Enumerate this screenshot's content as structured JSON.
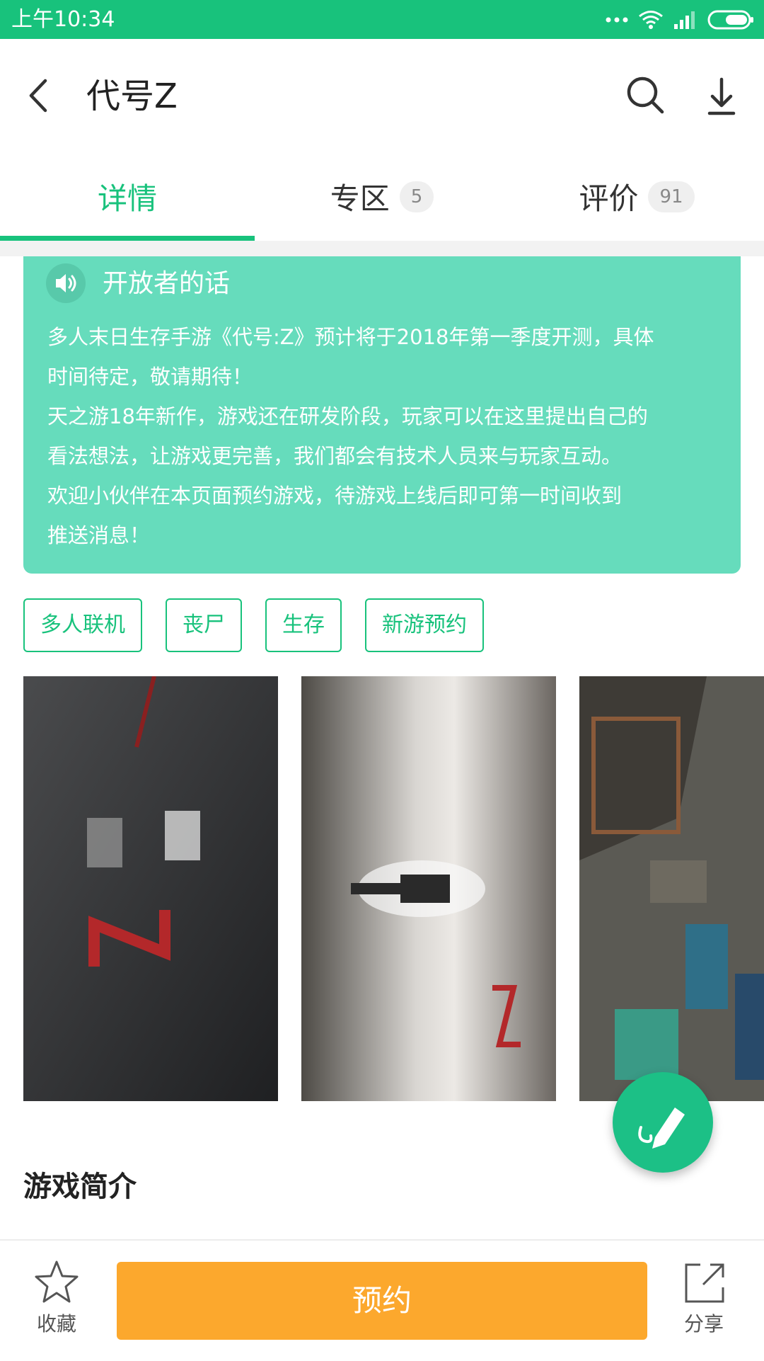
{
  "status_bar": {
    "time": "上午10:34"
  },
  "header": {
    "title": "代号Z"
  },
  "tabs": [
    {
      "label": "详情",
      "badge": ""
    },
    {
      "label": "专区",
      "badge": "5"
    },
    {
      "label": "评价",
      "badge": "91"
    }
  ],
  "developer_note": {
    "title": "开放者的话",
    "text": "多人末日生存手游《代号:Z》预计将于2018年第一季度开测，具体\n时间待定，敬请期待！\n天之游18年新作，游戏还在研发阶段，玩家可以在这里提出自己的\n看法想法，让游戏更完善，我们都会有技术人员来与玩家互动。\n欢迎小伙伴在本页面预约游戏，待游戏上线后即可第一时间收到\n推送消息！"
  },
  "tags": [
    "多人联机",
    "丧尸",
    "生存",
    "新游预约"
  ],
  "section": {
    "intro_title": "游戏简介"
  },
  "bottom_bar": {
    "favorite_label": "收藏",
    "reserve_label": "预约",
    "share_label": "分享"
  },
  "colors": {
    "accent": "#18c27c",
    "card": "#66dcbc",
    "reserve": "#fca82d"
  }
}
